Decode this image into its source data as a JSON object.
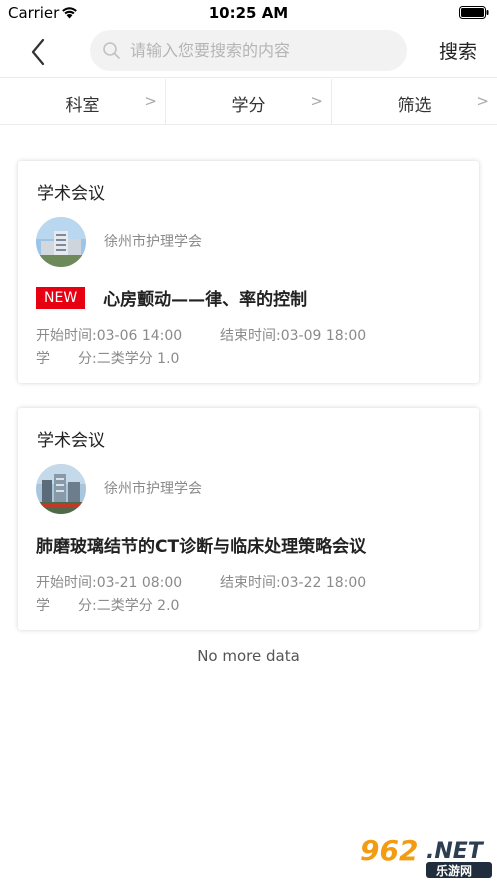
{
  "status_bar": {
    "carrier": "Carrier",
    "time": "10:25 AM"
  },
  "header": {
    "search_placeholder": "请输入您要搜索的内容",
    "search_button": "搜索"
  },
  "filters": [
    {
      "label": "科室",
      "arrow": ">"
    },
    {
      "label": "学分",
      "arrow": ">"
    },
    {
      "label": "筛选",
      "arrow": ">"
    }
  ],
  "cards": [
    {
      "type": "学术会议",
      "org": "徐州市护理学会",
      "badge": "NEW",
      "title": "心房颤动——律、率的控制",
      "start": "开始时间:03-06 14:00",
      "end": "结束时间:03-09 18:00",
      "credit": "学　　分:二类学分 1.0"
    },
    {
      "type": "学术会议",
      "org": "徐州市护理学会",
      "title": "肺磨玻璃结节的CT诊断与临床处理策略会议",
      "start": "开始时间:03-21 08:00",
      "end": "结束时间:03-22 18:00",
      "credit": "学　　分:二类学分 2.0"
    }
  ],
  "footer": {
    "no_more": "No more data"
  },
  "watermark": {
    "text": "962.NET 乐游网"
  },
  "colors": {
    "accent_red": "#e60012",
    "text_gray": "#8a8a8a",
    "divider": "#ececec"
  }
}
